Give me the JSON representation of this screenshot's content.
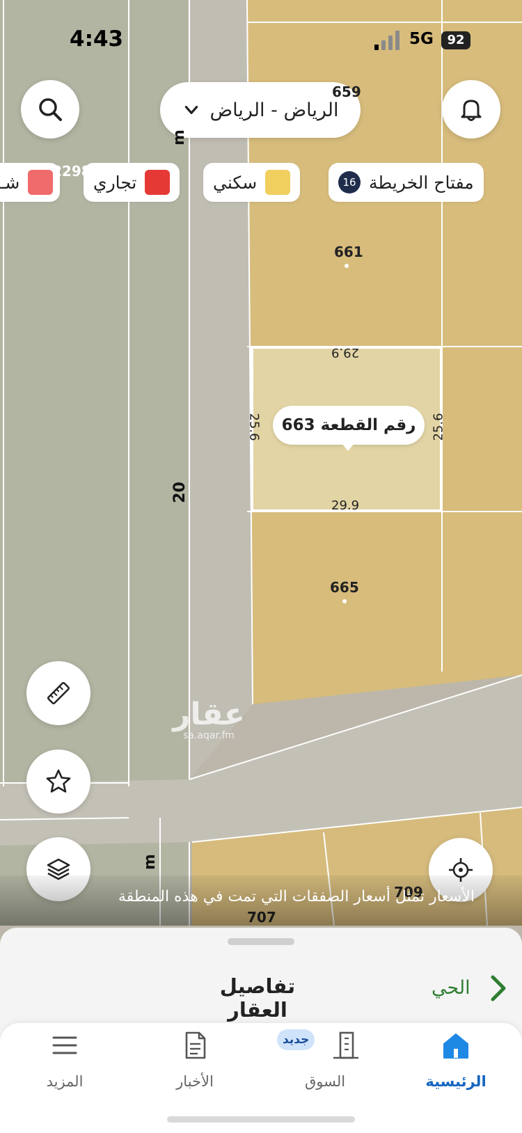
{
  "status_bar": {
    "time": "4:43",
    "network": "5G",
    "battery": "92"
  },
  "header": {
    "city_selector": "الرياض - الرياض"
  },
  "map_key": {
    "title": "مفتاح الخريطة",
    "count": "16",
    "items": [
      {
        "label": "سكني",
        "color": "#f1cf5e"
      },
      {
        "label": "تجاري",
        "color": "#e53935"
      },
      {
        "label": "شـ",
        "color": "#f06b6b"
      }
    ]
  },
  "map": {
    "plot_numbers": [
      "659",
      "661",
      "665",
      "709",
      "707",
      "2298"
    ],
    "selected_plot": {
      "label": "رقم القطعة 663",
      "dimensions": {
        "top": "29.9",
        "bottom": "29.9",
        "left": "25.6",
        "right": "25.6"
      }
    },
    "street_labels": [
      "20",
      "m",
      "m"
    ],
    "watermark": {
      "main": "عقار",
      "sub": "sa.aqar.fm"
    }
  },
  "notice": "الأسعار تمثل أسعار الصفقات التي تمت في هذه المنطقة",
  "sheet": {
    "title": "تفاصيل العقار",
    "district": "الحي"
  },
  "tabs": {
    "home": "الرئيسية",
    "market": "السوق",
    "new_badge": "جديد",
    "news": "الأخبار",
    "more": "المزيد"
  },
  "colors": {
    "accent": "#1565c0",
    "district_green": "#2e7d32",
    "residential": "#d7bc7c"
  }
}
